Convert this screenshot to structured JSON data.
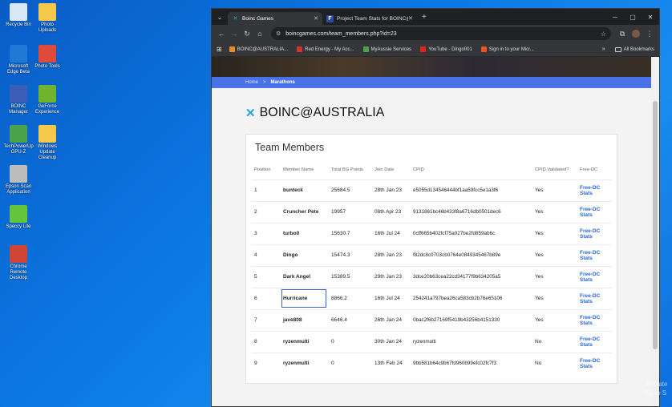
{
  "desktop": {
    "icons": [
      {
        "label": "Recycle Bin",
        "color": "#d9e6f5"
      },
      {
        "label": "Photo Uploads",
        "color": "#f3c84b"
      },
      {
        "label": "Microsoft Edge Beta",
        "color": "#1f7ad6"
      },
      {
        "label": "Photo Tools",
        "color": "#e04a3a"
      },
      {
        "label": "BOINC Manager",
        "color": "#3b5fb8"
      },
      {
        "label": "GeForce Experience",
        "color": "#6fb42c"
      },
      {
        "label": "TechPowerUp GPU-Z",
        "color": "#4aa34a"
      },
      {
        "label": "Windows Update Cleanup",
        "color": "#f3c84b"
      },
      {
        "label": "Epson Scan Application",
        "color": "#bcbcbc"
      },
      {
        "label": "Speccy Lite",
        "color": "#66c43a"
      },
      {
        "label": "Chrome Remote Desktop",
        "color": "#d04436"
      }
    ],
    "watermark": [
      "Activate",
      "Go to S"
    ]
  },
  "browser": {
    "tabs": [
      {
        "title": "Boinc Games",
        "active": true
      },
      {
        "title": "Project Team Stats for BOINC@",
        "active": false
      }
    ],
    "url": "boincgames.com/team_members.php?id=23",
    "bookmarks": [
      {
        "label": "BOINC@AUSTRALIA...",
        "color": "#f08a1c"
      },
      {
        "label": "Red Energy - My Acc...",
        "color": "#d6302f"
      },
      {
        "label": "MyAussie Services",
        "color": "#4aa34a"
      },
      {
        "label": "YouTube - Dingo001",
        "color": "#e62117"
      },
      {
        "label": "Sign in to your Micr...",
        "color": "#f25022"
      }
    ],
    "all_bookmarks": "All Bookmarks"
  },
  "page": {
    "breadcrumb": {
      "home": "Home",
      "sep": ">",
      "current": "Marathons"
    },
    "team_name": "BOINC@AUSTRALIA",
    "section_title": "Team Members",
    "columns": [
      "Position",
      "Member Name",
      "Total BG Points",
      "Join Date",
      "CPID",
      "CPID Validated?",
      "Free-DC"
    ],
    "rows": [
      {
        "pos": "1",
        "name": "bunteck",
        "points": "25684.5",
        "date": "28th Jan 23",
        "cpid": "e5055d134546444bf1aa59fcc5e1a3f6",
        "valid": "Yes",
        "link": "Free-DC Stats"
      },
      {
        "pos": "2",
        "name": "Cruncher Pete",
        "points": "19957",
        "date": "08th Apr 23",
        "cpid": "9131861bc46b433f8a6716db0501dec6",
        "valid": "Yes",
        "link": "Free-DC Stats"
      },
      {
        "pos": "3",
        "name": "turbo0",
        "points": "15630.7",
        "date": "16th Jul 24",
        "cpid": "0cff665b402fcf75a027be2fd859ab6c",
        "valid": "Yes",
        "link": "Free-DC Stats"
      },
      {
        "pos": "4",
        "name": "Dingo",
        "points": "15474.3",
        "date": "28th Jan 23",
        "cpid": "f82dc8c0703cb0764e0849345467b89e",
        "valid": "Yes",
        "link": "Free-DC Stats"
      },
      {
        "pos": "5",
        "name": "Dark Angel",
        "points": "15389.5",
        "date": "29th Jan 23",
        "cpid": "3dce20b63cea22cd34177f9b634205a5",
        "valid": "Yes",
        "link": "Free-DC Stats"
      },
      {
        "pos": "6",
        "name": "Hurricane",
        "points": "8866.2",
        "date": "16th Jul 24",
        "cpid": "254241a797bea26ca583cb2b76e65106",
        "valid": "Yes",
        "link": "Free-DC Stats"
      },
      {
        "pos": "7",
        "name": "jave808",
        "points": "6646.4",
        "date": "26th Jan 24",
        "cpid": "0bac2f6b27169f5419b43256b4151330",
        "valid": "Yes",
        "link": "Free-DC Stats"
      },
      {
        "pos": "8",
        "name": "ryzenmulti",
        "points": "0",
        "date": "30th Jan 24",
        "cpid": "ryzenmulti",
        "valid": "No",
        "link": "Free-DC Stats"
      },
      {
        "pos": "9",
        "name": "ryzenmulti",
        "points": "0",
        "date": "13th Feb 24",
        "cpid": "9bb581b64c9b67fd960b99efc02fc7f3",
        "valid": "No",
        "link": "Free-DC Stats"
      }
    ]
  }
}
